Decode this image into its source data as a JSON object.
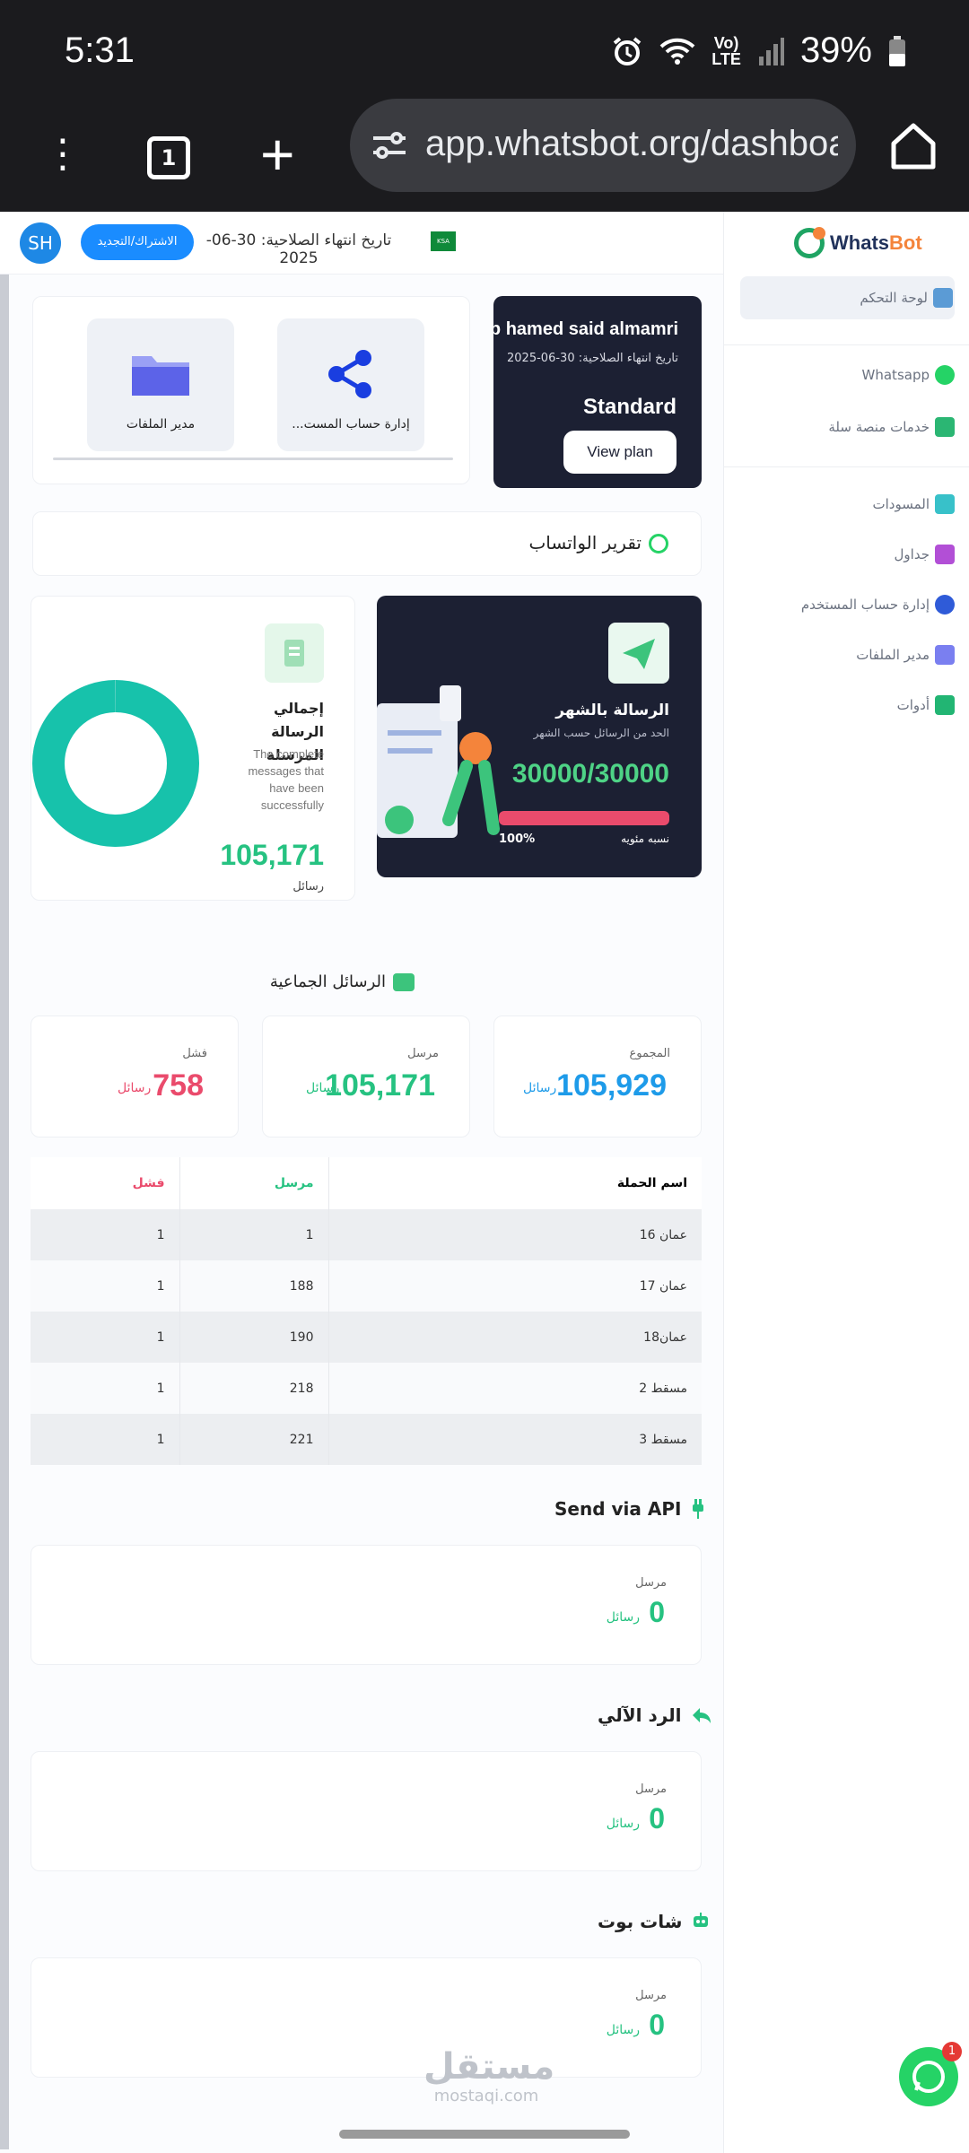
{
  "status_bar": {
    "time": "5:31",
    "battery": "39%",
    "network": "Vo) LTE"
  },
  "browser": {
    "tab_count": "1",
    "url": "app.whatsbot.org/dashboard"
  },
  "topbar": {
    "avatar": "SH",
    "renew_label": "الاشتراك/التجديد",
    "expiry_text": "تاريخ انتهاء الصلاحية: 30-06-2025",
    "flag_label": "KSA"
  },
  "sidebar": {
    "logo_a": "Whats",
    "logo_b": "Bot",
    "items": [
      {
        "label": "لوحة التحكم",
        "color": "#5b9bd5"
      },
      {
        "label": "Whatsapp",
        "color": "#25d366"
      },
      {
        "label": "خدمات منصة سلة",
        "color": "#2bb673"
      },
      {
        "label": "المسودات",
        "color": "#38c1c9"
      },
      {
        "label": "جداول",
        "color": "#b24fd6"
      },
      {
        "label": "إدارة حساب المستخدم",
        "color": "#2f5bd8"
      },
      {
        "label": "مدير الملفات",
        "color": "#7a7ff0"
      },
      {
        "label": "أدوات",
        "color": "#22b573"
      }
    ]
  },
  "quick_links": {
    "account": "إدارة حساب المست...",
    "files": "مدير الملفات"
  },
  "plan": {
    "name": "b hamed said almamri",
    "expiry": "تاريخ انتهاء الصلاحية: 30-06-2025",
    "tier": "Standard",
    "button": "View plan"
  },
  "report": {
    "title": "تقرير الواتساب"
  },
  "monthly": {
    "title": "الرسالة بالشهر",
    "subtitle": "الحد من الرسائل حسب الشهر",
    "count": "30000/30000",
    "progress": 1.0,
    "percent_text": "100%",
    "percent_label": "نسبه مئويه"
  },
  "total": {
    "title": "إجمالي الرسالة المرسلة",
    "description": "The complete messages that have been successfully",
    "value": "105,171",
    "unit": "رسائل",
    "sent_fraction": 0.999
  },
  "bulk": {
    "title": "الرسائل الجماعية",
    "stats": [
      {
        "label": "المجموع",
        "value": "105,929",
        "unit": "رسائل",
        "color": "#1e9be9"
      },
      {
        "label": "مرسل",
        "value": "105,171",
        "unit": "رسائل",
        "color": "#26c281"
      },
      {
        "label": "فشل",
        "value": "758",
        "unit": "رسائل",
        "color": "#ea4b6c"
      }
    ]
  },
  "campaigns": {
    "headers": {
      "name": "اسم الحملة",
      "sent": "مرسل",
      "failed": "فشل"
    },
    "rows": [
      {
        "name": "عمان 16",
        "sent": "1",
        "failed": "1"
      },
      {
        "name": "عمان 17",
        "sent": "188",
        "failed": "1"
      },
      {
        "name": "عمان18",
        "sent": "190",
        "failed": "1"
      },
      {
        "name": "مسقط 2",
        "sent": "218",
        "failed": "1"
      },
      {
        "name": "مسقط 3",
        "sent": "221",
        "failed": "1"
      }
    ]
  },
  "api": {
    "title": "Send via API",
    "label": "مرسل",
    "value": "0",
    "unit": "رسائل"
  },
  "auto_reply": {
    "title": "الرد الآلي",
    "label": "مرسل",
    "value": "0",
    "unit": "رسائل"
  },
  "chatbot": {
    "title": "شات بوت",
    "label": "مرسل",
    "value": "0",
    "unit": "رسائل"
  },
  "watermark": {
    "ar": "مستقل",
    "en": "mostaqi.com"
  },
  "fab": {
    "badge": "1"
  }
}
